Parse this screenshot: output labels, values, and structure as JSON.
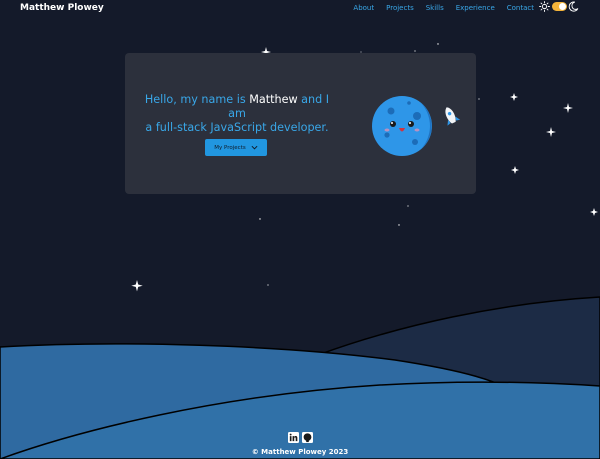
{
  "header": {
    "title": "Matthew Plowey",
    "nav": [
      "About",
      "Projects",
      "Skills",
      "Experience",
      "Contact"
    ],
    "theme_toggle": {
      "state": "dark",
      "icons": [
        "sun-icon",
        "moon-icon"
      ]
    }
  },
  "hero": {
    "line1_prefix": "Hello, my name is ",
    "name": "Matthew",
    "line1_suffix": " and I am",
    "line2": "a full-stack JavaScript developer.",
    "button_label": "My Projects"
  },
  "footer": {
    "icons": [
      "linkedin-icon",
      "github-icon"
    ],
    "copyright": "© Matthew Plowey 2023"
  },
  "colors": {
    "background": "#141a2a",
    "accent": "#39a7e8",
    "card": "#2c303c",
    "button": "#2196e0",
    "hill_front": "#2f6aa1",
    "hill_back": "#1c2b45"
  }
}
